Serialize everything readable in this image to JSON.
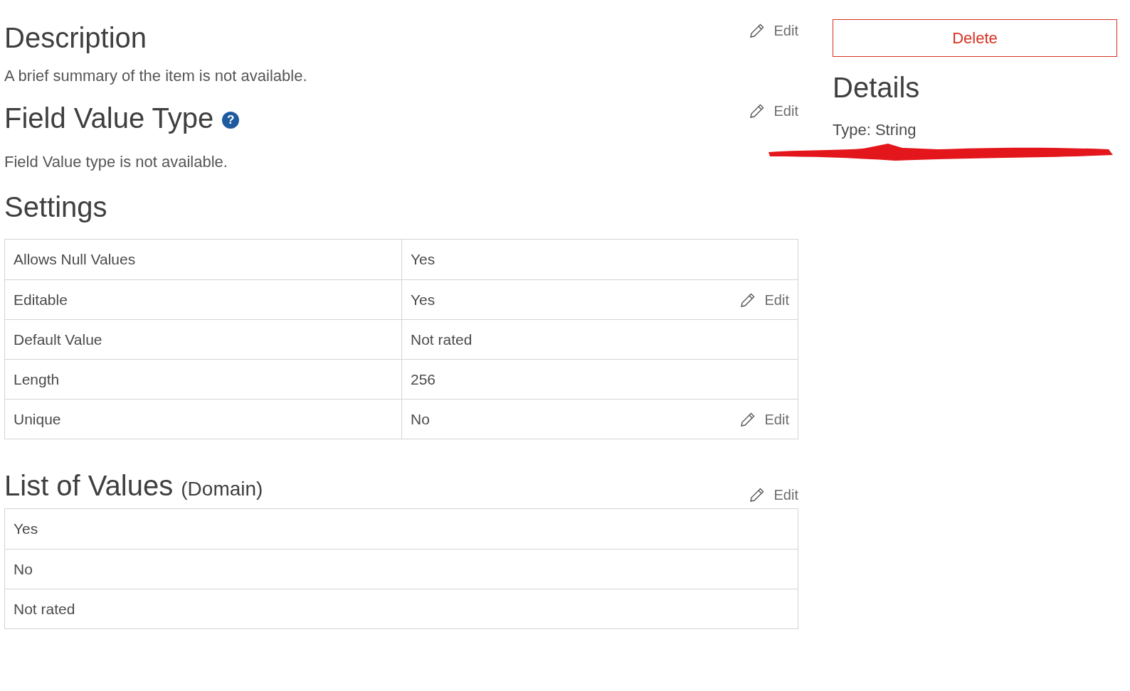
{
  "description": {
    "title": "Description",
    "edit": "Edit",
    "text": "A brief summary of the item is not available."
  },
  "field_value_type": {
    "title": "Field Value Type",
    "help": "?",
    "edit": "Edit",
    "text": "Field Value type is not available."
  },
  "settings": {
    "title": "Settings",
    "rows": [
      {
        "label": "Allows Null Values",
        "value": "Yes"
      },
      {
        "label": "Editable",
        "value": "Yes",
        "edit": "Edit"
      },
      {
        "label": "Default Value",
        "value": "Not rated"
      },
      {
        "label": "Length",
        "value": "256"
      },
      {
        "label": "Unique",
        "value": "No",
        "edit": "Edit"
      }
    ]
  },
  "list_of_values": {
    "title": "List of Values",
    "subtitle": "(Domain)",
    "edit": "Edit",
    "values": [
      "Yes",
      "No",
      "Not rated"
    ]
  },
  "sidebar": {
    "delete": "Delete",
    "title": "Details",
    "type": "Type: String"
  }
}
